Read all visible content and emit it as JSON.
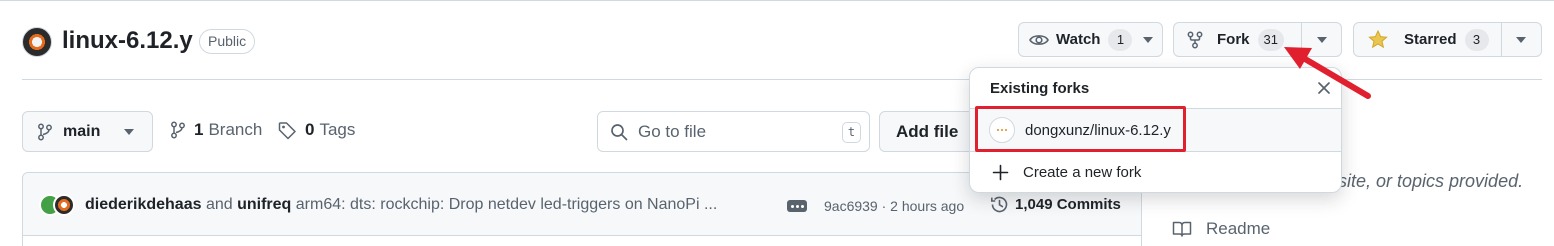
{
  "repo": {
    "name": "linux-6.12.y",
    "visibility": "Public"
  },
  "actions": {
    "watch": {
      "label": "Watch",
      "count": "1"
    },
    "fork": {
      "label": "Fork",
      "count": "31"
    },
    "star": {
      "label": "Starred",
      "count": "3"
    }
  },
  "branch_bar": {
    "branch": "main",
    "branches_count": "1",
    "branches_label": "Branch",
    "tags_count": "0",
    "tags_label": "Tags",
    "search_placeholder": "Go to file",
    "search_shortcut": "t",
    "add_file": "Add file"
  },
  "latest_commit": {
    "author1": "diederikdehaas",
    "and": "and",
    "author2": "unifreq",
    "message": "arm64: dts: rockchip: Drop netdev led-triggers on NanoPi ...",
    "hash_time": "9ac6939 · 2 hours ago",
    "commits_count": "1,049 Commits"
  },
  "sidebar": {
    "about_fragment": "site, or topics provided.",
    "readme": "Readme"
  },
  "fork_dropdown": {
    "title": "Existing forks",
    "existing_fork": "dongxunz/linux-6.12.y",
    "create_new": "Create a new fork"
  },
  "annotation": {
    "highlight_color": "#e0202e"
  }
}
